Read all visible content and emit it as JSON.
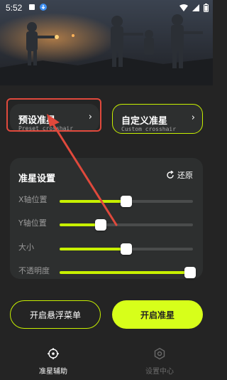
{
  "status_bar": {
    "time": "5:52"
  },
  "preset_card": {
    "title": "预设准星",
    "subtitle": "Preset crosshair",
    "chevron": "›"
  },
  "custom_card": {
    "title": "自定义准星",
    "subtitle": "Custom crosshair",
    "chevron": "›"
  },
  "crosshair_settings": {
    "title": "准星设置",
    "reset_label": "还原",
    "sliders": [
      {
        "label": "X轴位置",
        "value": 0.5
      },
      {
        "label": "Y轴位置",
        "value": 0.31
      },
      {
        "label": "大小",
        "value": 0.5
      },
      {
        "label": "不透明度",
        "value": 0.98
      }
    ]
  },
  "actions": {
    "floating_menu_label": "开启悬浮菜单",
    "start_crosshair_label": "开启准星"
  },
  "bottom_nav": {
    "items": [
      {
        "label": "准星辅助",
        "active": true
      },
      {
        "label": "设置中心",
        "active": false
      }
    ]
  },
  "colors": {
    "accent": "#c7f000",
    "annotation": "#e0493c"
  }
}
